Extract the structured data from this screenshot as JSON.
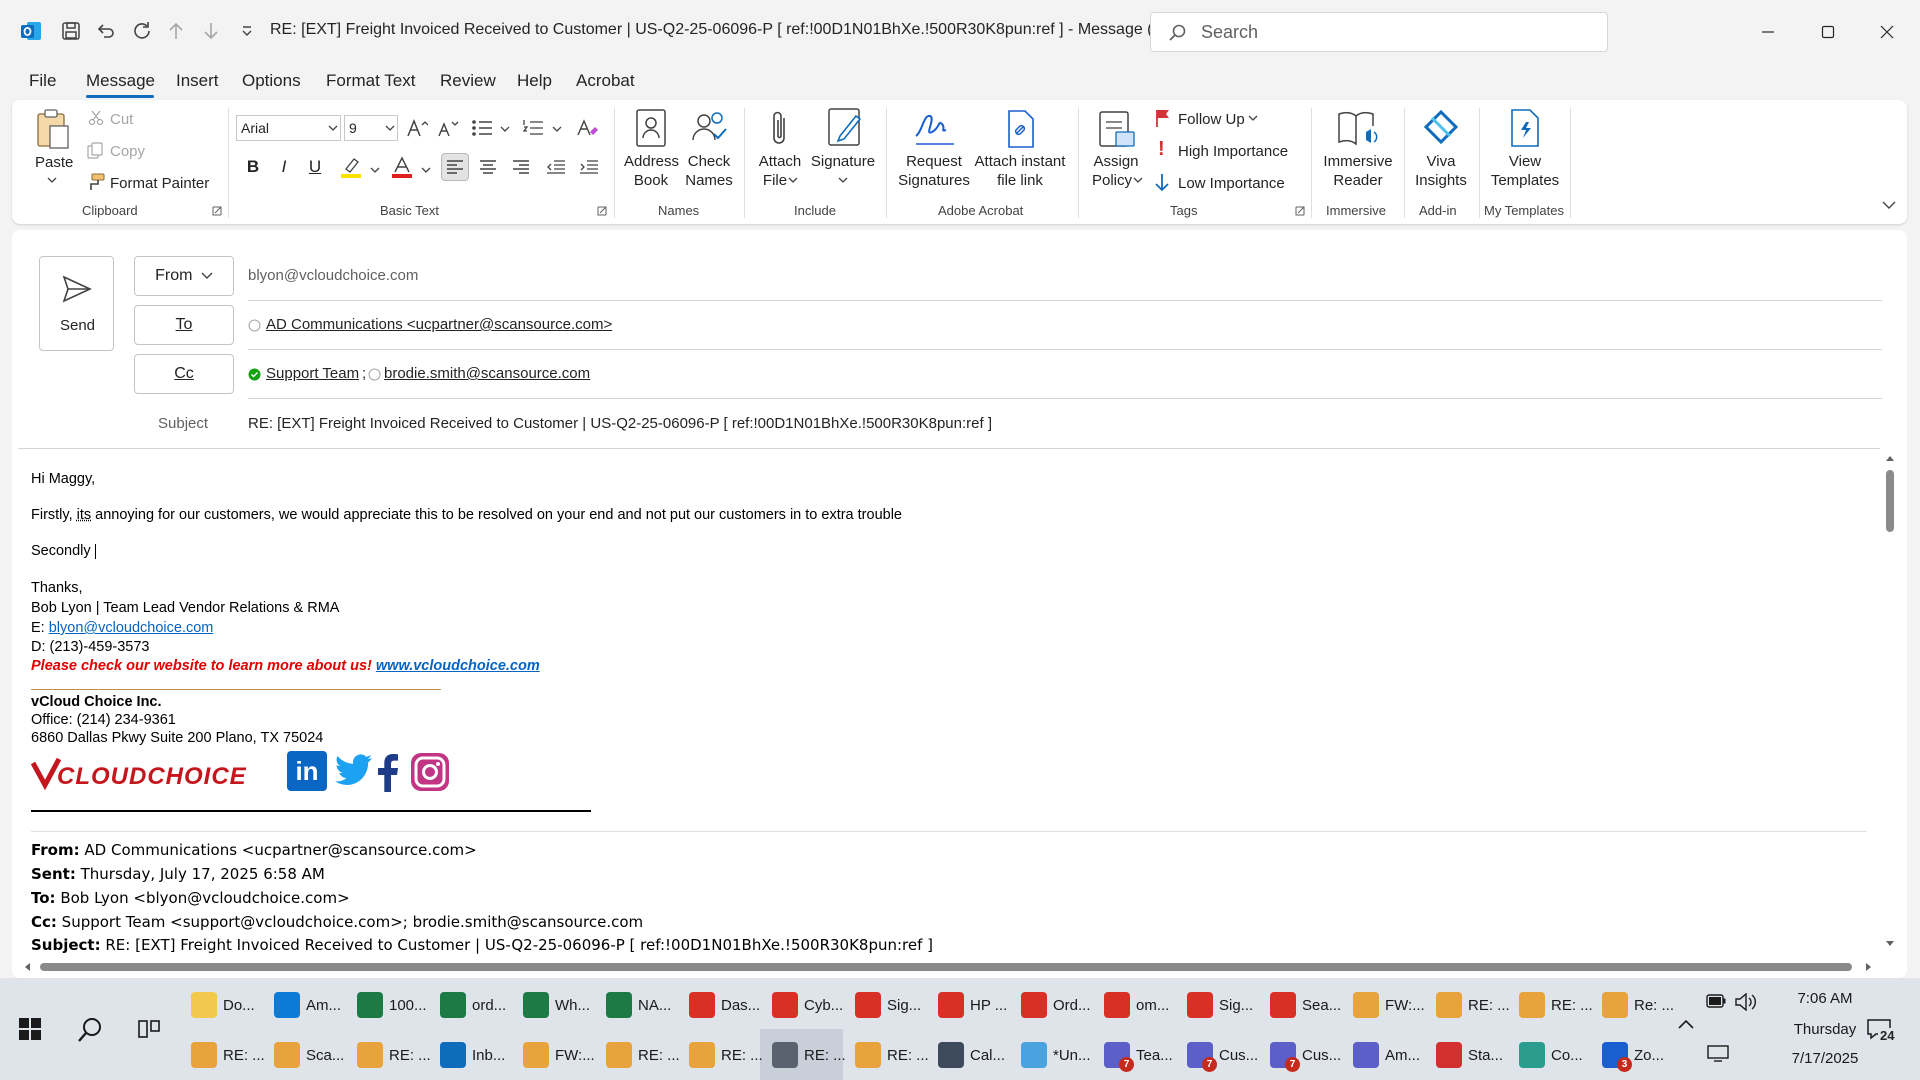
{
  "window": {
    "title": "RE: [EXT] Freight Invoiced Received to Customer | US-Q2-25-06096-P    [ ref:!00D1N01BhXe.!500R30K8pun:ref ]  -  Message (HT...",
    "search_placeholder": "Search"
  },
  "menu": {
    "items": [
      "File",
      "Message",
      "Insert",
      "Options",
      "Format Text",
      "Review",
      "Help",
      "Acrobat"
    ],
    "active": "Message"
  },
  "ribbon": {
    "clipboard": {
      "paste": "Paste",
      "cut": "Cut",
      "copy": "Copy",
      "format_painter": "Format Painter",
      "label": "Clipboard"
    },
    "basic_text": {
      "font": "Arial",
      "size": "9",
      "bold": "B",
      "italic": "I",
      "underline": "U",
      "label": "Basic Text"
    },
    "names": {
      "address_book_1": "Address",
      "address_book_2": "Book",
      "check_names_1": "Check",
      "check_names_2": "Names",
      "label": "Names"
    },
    "include": {
      "attach_file_1": "Attach",
      "attach_file_2": "File",
      "signature": "Signature",
      "label": "Include"
    },
    "adobe": {
      "request_1": "Request",
      "request_2": "Signatures",
      "attach_link_1": "Attach instant",
      "attach_link_2": "file link",
      "label": "Adobe Acrobat"
    },
    "tags": {
      "assign_1": "Assign",
      "assign_2": "Policy",
      "follow_up": "Follow Up",
      "high": "High Importance",
      "low": "Low Importance",
      "label": "Tags"
    },
    "immersive": {
      "reader_1": "Immersive",
      "reader_2": "Reader",
      "label": "Immersive"
    },
    "addin": {
      "viva_1": "Viva",
      "viva_2": "Insights",
      "label": "Add-in"
    },
    "templates": {
      "view_1": "View",
      "view_2": "Templates",
      "label": "My Templates"
    }
  },
  "compose": {
    "send": "Send",
    "from_label": "From",
    "from_value": "blyon@vcloudchoice.com",
    "to_label": "To",
    "to_value": "AD Communications <ucpartner@scansource.com>",
    "cc_label": "Cc",
    "cc_1": "Support Team",
    "cc_sep": ";",
    "cc_2": "brodie.smith@scansource.com",
    "subject_label": "Subject",
    "subject_value": "RE: [EXT] Freight Invoiced Received to Customer | US-Q2-25-06096-P    [ ref:!00D1N01BhXe.!500R30K8pun:ref ]"
  },
  "body": {
    "greeting": "Hi Maggy,",
    "line1_a": "Firstly, ",
    "line1_its": "its",
    "line1_b": " annoying for our customers, we would appreciate this to be resolved on your end and not put our customers in to extra trouble",
    "line2": "Secondly ",
    "thanks": "Thanks,",
    "sig_name": "Bob Lyon | Team Lead Vendor Relations & RMA",
    "sig_email_label": "E: ",
    "sig_email": "blyon@vcloudchoice.com",
    "sig_phone": "D: (213)-459-3573",
    "sig_promo": "Please check our website to learn more about us! ",
    "sig_web": "www.vcloudchoice.com",
    "company": "vCloud Choice Inc.",
    "office": "Office: (214) 234-9361",
    "address": "6860 Dallas Pkwy Suite 200 Plano, TX 75024",
    "logo_text": "VCLOUDCHOICE",
    "quoted": {
      "from_label": "From:",
      "from": " AD Communications <ucpartner@scansource.com>",
      "sent_label": "Sent:",
      "sent": " Thursday, July 17, 2025 6:58 AM",
      "to_label": "To:",
      "to": " Bob Lyon <blyon@vcloudchoice.com>",
      "cc_label": "Cc:",
      "cc": " Support Team <support@vcloudchoice.com>; brodie.smith@scansource.com",
      "subject_label": "Subject:",
      "subject": " RE: [EXT] Freight Invoiced Received to Customer | US-Q2-25-06096-P [ ref:!00D1N01BhXe.!500R30K8pun:ref ]"
    }
  },
  "taskbar": {
    "row1": [
      {
        "label": "Do...",
        "color": "#f2c94c",
        "icon": "folder-icon"
      },
      {
        "label": "Am...",
        "color": "#0c7bd8",
        "icon": "edge-icon"
      },
      {
        "label": "100...",
        "color": "#1d7a45",
        "icon": "excel-icon"
      },
      {
        "label": "ord...",
        "color": "#1d7a45",
        "icon": "excel-icon"
      },
      {
        "label": "Wh...",
        "color": "#1d7a45",
        "icon": "excel-icon"
      },
      {
        "label": "NA...",
        "color": "#1d7a45",
        "icon": "excel-icon"
      },
      {
        "label": "Das...",
        "color": "#d93025",
        "icon": "chrome-icon"
      },
      {
        "label": "Cyb...",
        "color": "#d93025",
        "icon": "chrome-icon"
      },
      {
        "label": "Sig...",
        "color": "#d93025",
        "icon": "chrome-icon"
      },
      {
        "label": "HP ...",
        "color": "#d93025",
        "icon": "chrome-icon"
      },
      {
        "label": "Ord...",
        "color": "#d93025",
        "icon": "chrome-icon"
      },
      {
        "label": "om...",
        "color": "#d93025",
        "icon": "chrome-icon"
      },
      {
        "label": "Sig...",
        "color": "#d93025",
        "icon": "chrome-icon"
      },
      {
        "label": "Sea...",
        "color": "#d93025",
        "icon": "chrome-icon"
      },
      {
        "label": "FW:...",
        "color": "#e8a33d",
        "icon": "mail-icon"
      },
      {
        "label": "RE: ...",
        "color": "#e8a33d",
        "icon": "mail-icon"
      },
      {
        "label": "RE: ...",
        "color": "#e8a33d",
        "icon": "mail-icon"
      },
      {
        "label": "Re: ...",
        "color": "#e8a33d",
        "icon": "mail-icon"
      }
    ],
    "row2": [
      {
        "label": "RE: ...",
        "color": "#e8a33d",
        "icon": "mail-icon"
      },
      {
        "label": "Sca...",
        "color": "#e8a33d",
        "icon": "mail-icon"
      },
      {
        "label": "RE: ...",
        "color": "#e8a33d",
        "icon": "mail-icon"
      },
      {
        "label": "Inb...",
        "color": "#0f6cbd",
        "icon": "outlook-icon"
      },
      {
        "label": "FW:...",
        "color": "#e8a33d",
        "icon": "mail-icon"
      },
      {
        "label": "RE: ...",
        "color": "#e8a33d",
        "icon": "mail-icon"
      },
      {
        "label": "RE: ...",
        "color": "#e8a33d",
        "icon": "mail-icon"
      },
      {
        "label": "RE: ...",
        "color": "#5a6270",
        "icon": "compose-icon"
      },
      {
        "label": "RE: ...",
        "color": "#e8a33d",
        "icon": "mail-icon"
      },
      {
        "label": "Cal...",
        "color": "#3c4a5c",
        "icon": "calculator-icon"
      },
      {
        "label": "*Un...",
        "color": "#4aa3df",
        "icon": "notepad-icon"
      },
      {
        "label": "Tea...",
        "color": "#5b5fc7",
        "icon": "teams-icon",
        "badge": "7"
      },
      {
        "label": "Cus...",
        "color": "#5b5fc7",
        "icon": "teams-icon",
        "badge": "7"
      },
      {
        "label": "Cus...",
        "color": "#5b5fc7",
        "icon": "teams-icon",
        "badge": "7"
      },
      {
        "label": "Am...",
        "color": "#5b5fc7",
        "icon": "teams-icon"
      },
      {
        "label": "Sta...",
        "color": "#d32f2f",
        "icon": "pdf-icon"
      },
      {
        "label": "Co...",
        "color": "#2a9d8f",
        "icon": "app-icon"
      },
      {
        "label": "Zo...",
        "color": "#1a5fd0",
        "icon": "zoho-icon",
        "badge": "3"
      }
    ],
    "time": "7:06 AM",
    "day": "Thursday",
    "date": "7/17/2025",
    "notification_count": "24"
  }
}
